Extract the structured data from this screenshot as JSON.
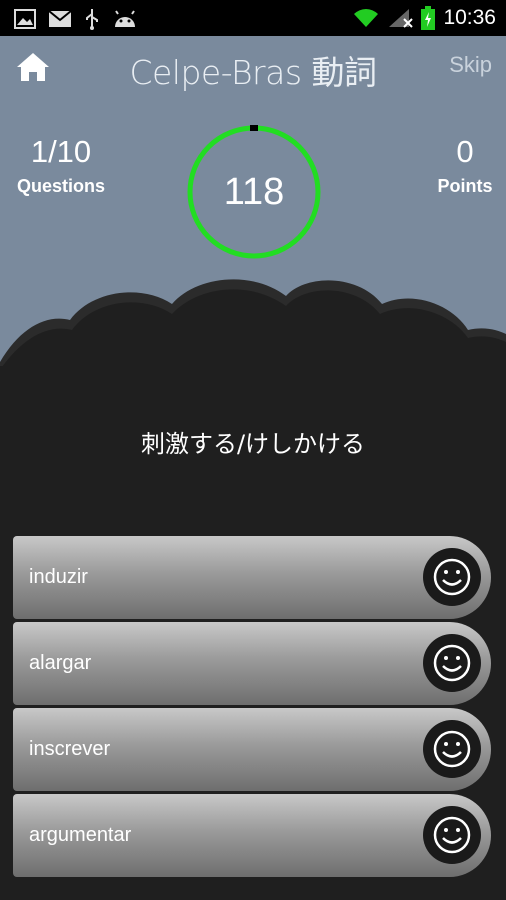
{
  "status_bar": {
    "time": "10:36",
    "left_icons": [
      "image-icon",
      "mail-icon",
      "usb-icon",
      "android-icon"
    ],
    "right_icons": [
      "wifi-icon",
      "signal-icon",
      "battery-icon"
    ]
  },
  "header": {
    "title": "Celpe-Bras 動詞",
    "skip_label": "Skip"
  },
  "stats": {
    "questions_value": "1/10",
    "questions_label": "Questions",
    "points_value": "0",
    "points_label": "Points"
  },
  "timer": {
    "value": "118",
    "progress": 0.99,
    "ring_color": "#22dd22"
  },
  "question": {
    "text": "刺激する/けしかける"
  },
  "answers": [
    {
      "label": "induzir"
    },
    {
      "label": "alargar"
    },
    {
      "label": "inscrever"
    },
    {
      "label": "argumentar"
    }
  ],
  "colors": {
    "header_bg": "#7a8a9d",
    "dark_bg": "#1f1f1f",
    "timer_ring": "#22dd22"
  }
}
